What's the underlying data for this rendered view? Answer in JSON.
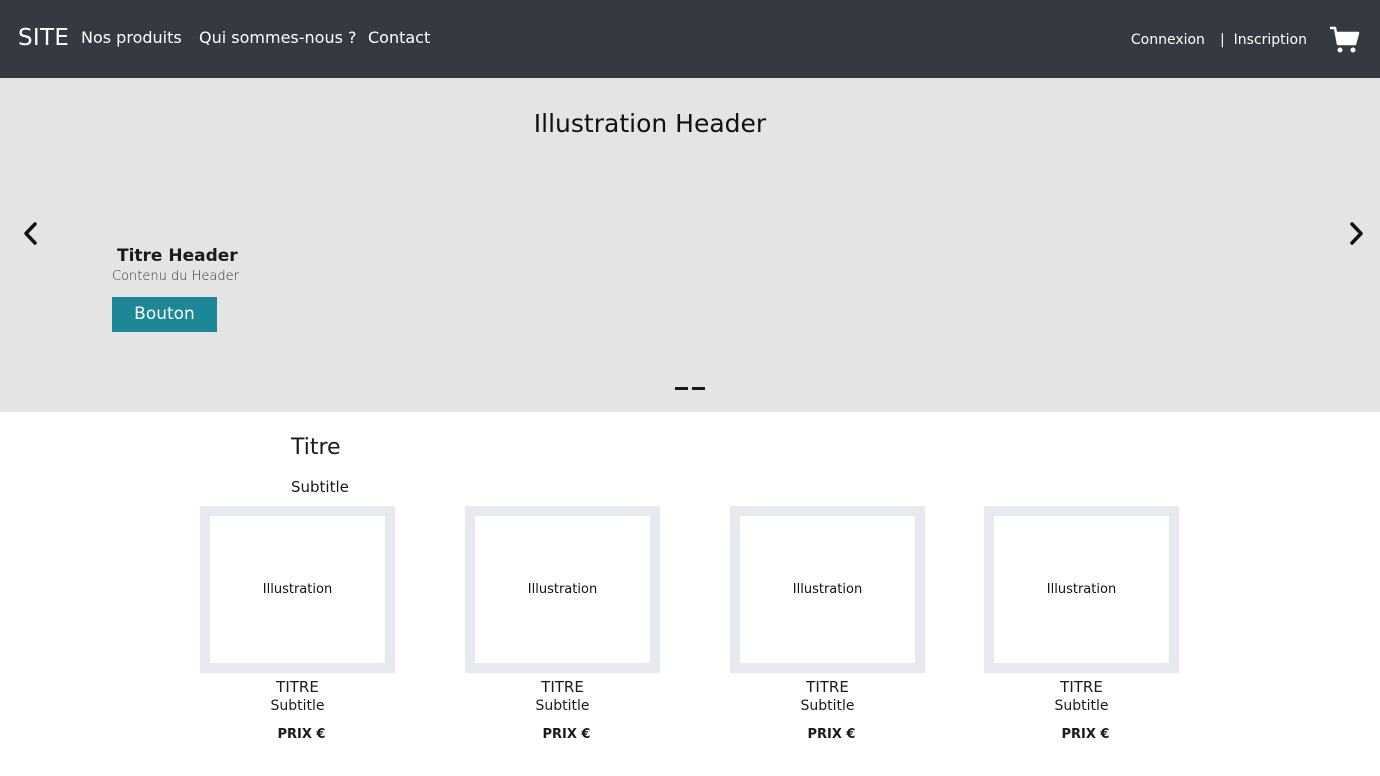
{
  "navbar": {
    "brand": "SITE",
    "links": [
      "Nos produits",
      "Qui sommes-nous ?",
      "Contact"
    ],
    "login": "Connexion",
    "separator": "|",
    "signup": "Inscription",
    "cart_icon": "shopping-cart-icon"
  },
  "hero": {
    "illustration": "Illustration Header",
    "title": "Titre Header",
    "content": "Contenu du Header",
    "button": "Bouton",
    "prev_icon": "chevron-left-icon",
    "next_icon": "chevron-right-icon",
    "slide_count": 2
  },
  "section": {
    "title": "Titre",
    "subtitle": "Subtitle",
    "cards": [
      {
        "illustration": "Illustration",
        "title": "TITRE",
        "subtitle": "Subtitle",
        "price": "PRIX €"
      },
      {
        "illustration": "Illustration",
        "title": "TITRE",
        "subtitle": "Subtitle",
        "price": "PRIX €"
      },
      {
        "illustration": "Illustration",
        "title": "TITRE",
        "subtitle": "Subtitle",
        "price": "PRIX €"
      },
      {
        "illustration": "Illustration",
        "title": "TITRE",
        "subtitle": "Subtitle",
        "price": "PRIX €"
      }
    ]
  },
  "colors": {
    "navbar_bg": "#353a42",
    "hero_bg": "#e4e4e4",
    "button_bg": "#1b8797",
    "card_frame": "#e6e9ed"
  }
}
